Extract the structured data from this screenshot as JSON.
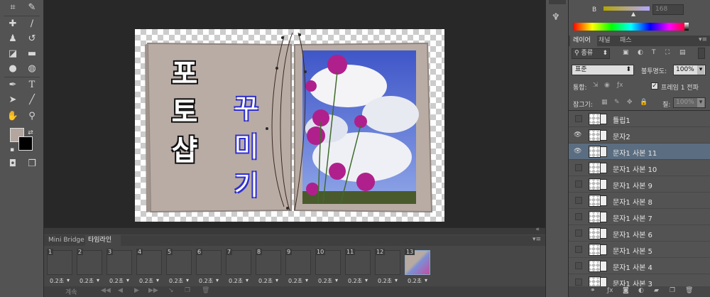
{
  "rgb_panel": {
    "channel_label": "B",
    "value": "168"
  },
  "layers_panel": {
    "tabs": [
      "레이어",
      "채널",
      "패스"
    ],
    "filter_kind": "종류",
    "blend_mode": "표준",
    "opacity_label": "불투명도:",
    "opacity_value": "100%",
    "unify_label": "통합:",
    "propagate_label": "프레임 1 전파",
    "lock_label": "잠그기:",
    "fill_label": "칠:",
    "fill_value": "100%",
    "layers": [
      {
        "name": "튤립1",
        "visible": false,
        "selected": false
      },
      {
        "name": "문자2",
        "visible": true,
        "selected": false
      },
      {
        "name": "문자1 사본 11",
        "visible": true,
        "selected": true
      },
      {
        "name": "문자1 사본 10",
        "visible": false,
        "selected": false
      },
      {
        "name": "문자1 사본 9",
        "visible": false,
        "selected": false
      },
      {
        "name": "문자1 사본 8",
        "visible": false,
        "selected": false
      },
      {
        "name": "문자1 사본 7",
        "visible": false,
        "selected": false
      },
      {
        "name": "문자1 사본 6",
        "visible": false,
        "selected": false
      },
      {
        "name": "문자1 사본 5",
        "visible": false,
        "selected": false
      },
      {
        "name": "문자1 사본 4",
        "visible": false,
        "selected": false
      },
      {
        "name": "문자1 사본 3",
        "visible": false,
        "selected": false
      }
    ]
  },
  "canvas": {
    "left_text": [
      "포",
      "토",
      "샵"
    ],
    "right_text": [
      "꾸",
      "미",
      "기"
    ]
  },
  "timeline": {
    "tabs": [
      "Mini Bridge",
      "타임라인"
    ],
    "loop_label": "계속",
    "frames": [
      {
        "num": "1",
        "delay": "0.2초"
      },
      {
        "num": "2",
        "delay": "0.2초"
      },
      {
        "num": "3",
        "delay": "0.2초"
      },
      {
        "num": "4",
        "delay": "0.2초"
      },
      {
        "num": "5",
        "delay": "0.2초"
      },
      {
        "num": "6",
        "delay": "0.2초"
      },
      {
        "num": "7",
        "delay": "0.2초"
      },
      {
        "num": "8",
        "delay": "0.2초"
      },
      {
        "num": "9",
        "delay": "0.2초"
      },
      {
        "num": "10",
        "delay": "0.2초"
      },
      {
        "num": "11",
        "delay": "0.2초"
      },
      {
        "num": "12",
        "delay": "0.2초"
      },
      {
        "num": "13",
        "delay": "0.2초"
      }
    ]
  },
  "colors": {
    "foreground": "#b3a69f",
    "background": "#000000",
    "selected_row": "#5b6d80"
  }
}
